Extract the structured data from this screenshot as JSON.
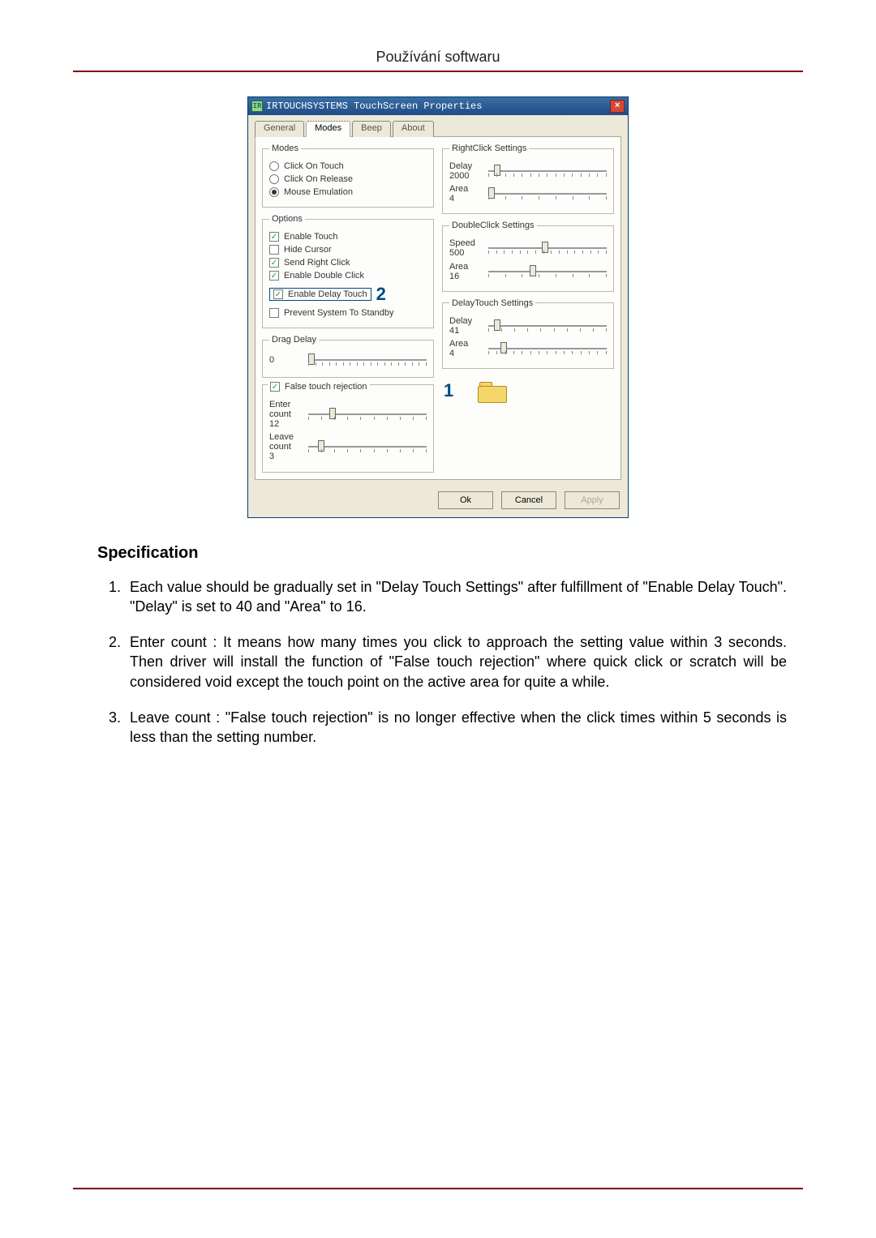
{
  "page_header": "Používání softwaru",
  "dialog": {
    "title": "IRTOUCHSYSTEMS TouchScreen Properties",
    "tabs": {
      "general": "General",
      "modes": "Modes",
      "beep": "Beep",
      "about": "About"
    },
    "groups": {
      "modes": "Modes",
      "rightclick": "RightClick Settings",
      "options": "Options",
      "doubleclick": "DoubleClick Settings",
      "delaytouch": "DelayTouch Settings",
      "dragdelay": "Drag Delay",
      "falsetouch": "False touch rejection"
    },
    "modes": {
      "click_on_touch": "Click On Touch",
      "click_on_release": "Click On Release",
      "mouse_emulation": "Mouse Emulation"
    },
    "options": {
      "enable_touch": "Enable Touch",
      "hide_cursor": "Hide Cursor",
      "send_right_click": "Send Right Click",
      "enable_double_click": "Enable Double Click",
      "enable_delay_touch": "Enable Delay Touch",
      "prevent_standby": "Prevent System To Standby"
    },
    "sliders": {
      "rc_delay_label": "Delay",
      "rc_delay_value": "2000",
      "rc_area_label": "Area",
      "rc_area_value": "4",
      "dc_speed_label": "Speed",
      "dc_speed_value": "500",
      "dc_area_label": "Area",
      "dc_area_value": "16",
      "dt_delay_label": "Delay",
      "dt_delay_value": "41",
      "dt_area_label": "Area",
      "dt_area_value": "4",
      "drag_value": "0",
      "enter_label": "Enter count",
      "enter_value": "12",
      "leave_label": "Leave count",
      "leave_value": "3"
    },
    "buttons": {
      "ok": "Ok",
      "cancel": "Cancel",
      "apply": "Apply"
    },
    "annotations": {
      "one": "1",
      "two": "2"
    }
  },
  "body": {
    "spec_title": "Specification",
    "items": {
      "i1": "Each value should be gradually set in \"Delay Touch Settings\" after fulfillment of \"Enable Delay Touch\". \"Delay\" is set to 40 and \"Area\" to 16.",
      "i2": "Enter count : It means how many times you click to approach the setting value within 3 seconds. Then driver will install the function of \"False touch rejection\" where quick click or scratch will be considered void except the touch point on the active area for quite a while.",
      "i3": "Leave count : \"False touch rejection\" is no longer effective when the click times within 5 seconds is less than the setting number."
    }
  }
}
